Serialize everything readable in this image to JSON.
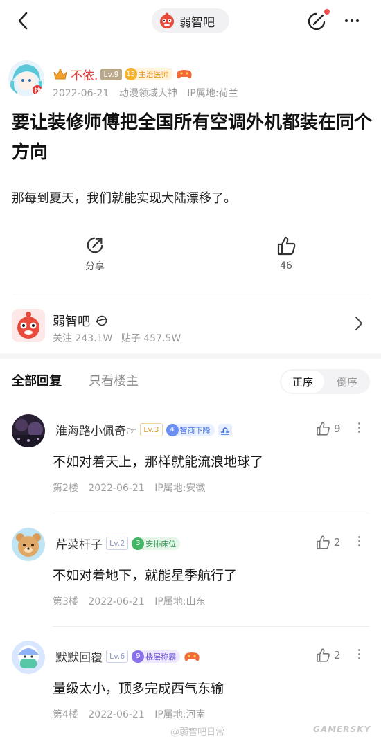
{
  "nav": {
    "forum_name": "弱智吧",
    "back_icon": "chevron-left-icon",
    "edit_icon": "edit-icon",
    "more_icon": "more-dots-icon"
  },
  "post": {
    "author": {
      "name": "不依.",
      "level": "Lv.9",
      "badge_num": "13",
      "badge_title": "主治医师",
      "date": "2022-06-21",
      "tag": "动漫领域大神",
      "ip": "IP属地:荷兰"
    },
    "title": "要让装修师傅把全国所有空调外机都装在同个方向",
    "body": "那每到夏天，我们就能实现大陆漂移了。",
    "actions": {
      "share_label": "分享",
      "like_count": "46"
    }
  },
  "forum_card": {
    "name": "弱智吧",
    "followers": "关注 243.1W",
    "posts": "贴子 457.5W"
  },
  "sort": {
    "all_replies": "全部回复",
    "owner_only": "只看楼主",
    "asc": "正序",
    "desc": "倒序"
  },
  "replies": [
    {
      "name": "淮海路小佩奇☞",
      "level": "Lv.3",
      "badge_num": "4",
      "badge_title": "智商下降",
      "content": "不如对着天上，那样就能流浪地球了",
      "floor": "第2楼",
      "date": "2022-06-21",
      "ip": "IP属地:安徽",
      "likes": "9"
    },
    {
      "name": "芹菜杆子",
      "level": "Lv.2",
      "badge_num": "3",
      "badge_title": "安排床位",
      "content": "不如对着地下，就能星季航行了",
      "floor": "第3楼",
      "date": "2022-06-21",
      "ip": "IP属地:山东",
      "likes": "2"
    },
    {
      "name": "默默回覆",
      "level": "Lv.6",
      "badge_num": "9",
      "badge_title": "楼层称霸",
      "content": "量级太小，顶多完成西气东输",
      "floor": "第4楼",
      "date": "2022-06-21",
      "ip": "IP属地:河南",
      "likes": "2"
    }
  ],
  "watermark": {
    "weibo": "@弱智吧日常",
    "site": "GAMERSKY"
  },
  "colors": {
    "author_name": "#e53935",
    "accent_red": "#f24b4b"
  }
}
